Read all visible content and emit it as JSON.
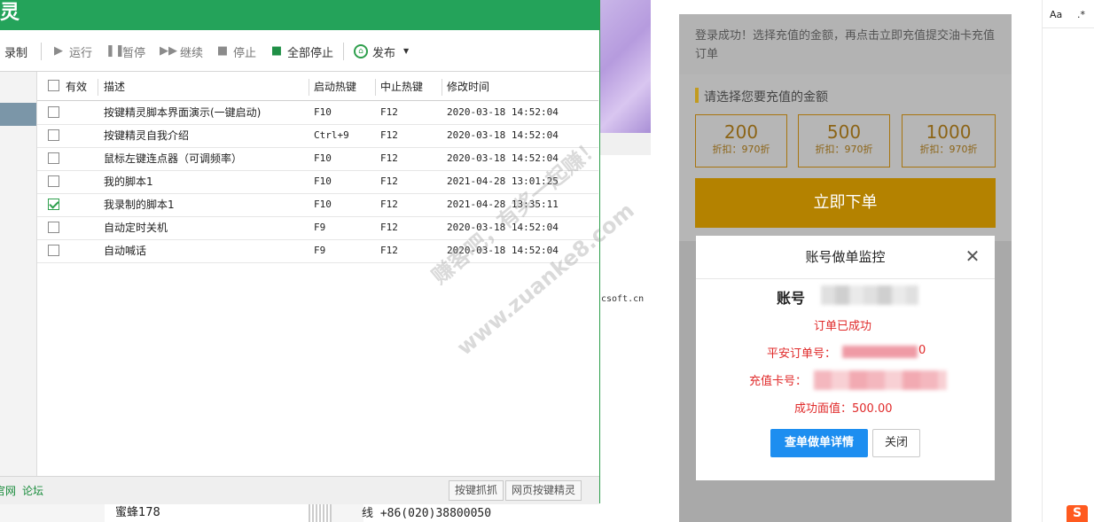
{
  "app": {
    "title_partial": "灵",
    "toolbar": {
      "record": "录制",
      "run": "运行",
      "pause": "暂停",
      "resume": "继续",
      "stop": "停止",
      "stop_all": "全部停止",
      "publish": "发布"
    },
    "table": {
      "headers": {
        "valid": "有效",
        "desc": "描述",
        "start_key": "启动热键",
        "stop_key": "中止热键",
        "modified": "修改时间"
      },
      "rows": [
        {
          "desc": "按键精灵脚本界面演示(一键启动)",
          "start": "F10",
          "stop": "F12",
          "time": "2020-03-18 14:52:04",
          "checked": false
        },
        {
          "desc": "按键精灵自我介绍",
          "start": "Ctrl+9",
          "stop": "F12",
          "time": "2020-03-18 14:52:04",
          "checked": false
        },
        {
          "desc": "鼠标左键连点器（可调频率）",
          "start": "F10",
          "stop": "F12",
          "time": "2020-03-18 14:52:04",
          "checked": false
        },
        {
          "desc": "我的脚本1",
          "start": "F10",
          "stop": "F12",
          "time": "2021-04-28 13:01:25",
          "checked": false
        },
        {
          "desc": "我录制的脚本1",
          "start": "F10",
          "stop": "F12",
          "time": "2021-04-28 13:35:11",
          "checked": true
        },
        {
          "desc": "自动定时关机",
          "start": "F9",
          "stop": "F12",
          "time": "2020-03-18 14:52:04",
          "checked": false
        },
        {
          "desc": "自动喊话",
          "start": "F9",
          "stop": "F12",
          "time": "2020-03-18 14:52:04",
          "checked": false
        }
      ]
    },
    "status": {
      "link1": "官网",
      "link2": "论坛",
      "btn1": "按键抓抓",
      "btn2": "网页按键精灵"
    }
  },
  "background": {
    "domain_fragment": "csoft.cn",
    "bee_name": "蜜蜂178",
    "phone_fragment": "线 +86(020)38800050"
  },
  "watermark": {
    "line1": "赚客吧，有奖一起赚！",
    "line2": "www.zuanke8.com"
  },
  "mobile": {
    "info": "登录成功！选择充值的金额，再点击立即充值提交油卡充值订单",
    "amount_title": "请选择您要充值的金额",
    "amounts": [
      {
        "value": "200",
        "discount": "折扣：970折"
      },
      {
        "value": "500",
        "discount": "折扣：970折"
      },
      {
        "value": "1000",
        "discount": "折扣：970折"
      }
    ],
    "order_button": "立即下单",
    "modal": {
      "title": "账号做单监控",
      "account_label": "账号",
      "order_success": "订单已成功",
      "pa_order_label": "平安订单号：",
      "pa_order_tail": "0",
      "card_label": "充值卡号：",
      "face_value": "成功面值：500.00",
      "detail_button": "查单做单详情",
      "close_button": "关闭"
    }
  },
  "editor_side": {
    "match_case": "Aa",
    "regex": ".*",
    "sogou": "S"
  },
  "colors": {
    "titlebar": "#24a35a",
    "accent_gold": "#b48200",
    "primary_blue": "#1d8ef0",
    "error_red": "#e02a2a"
  }
}
